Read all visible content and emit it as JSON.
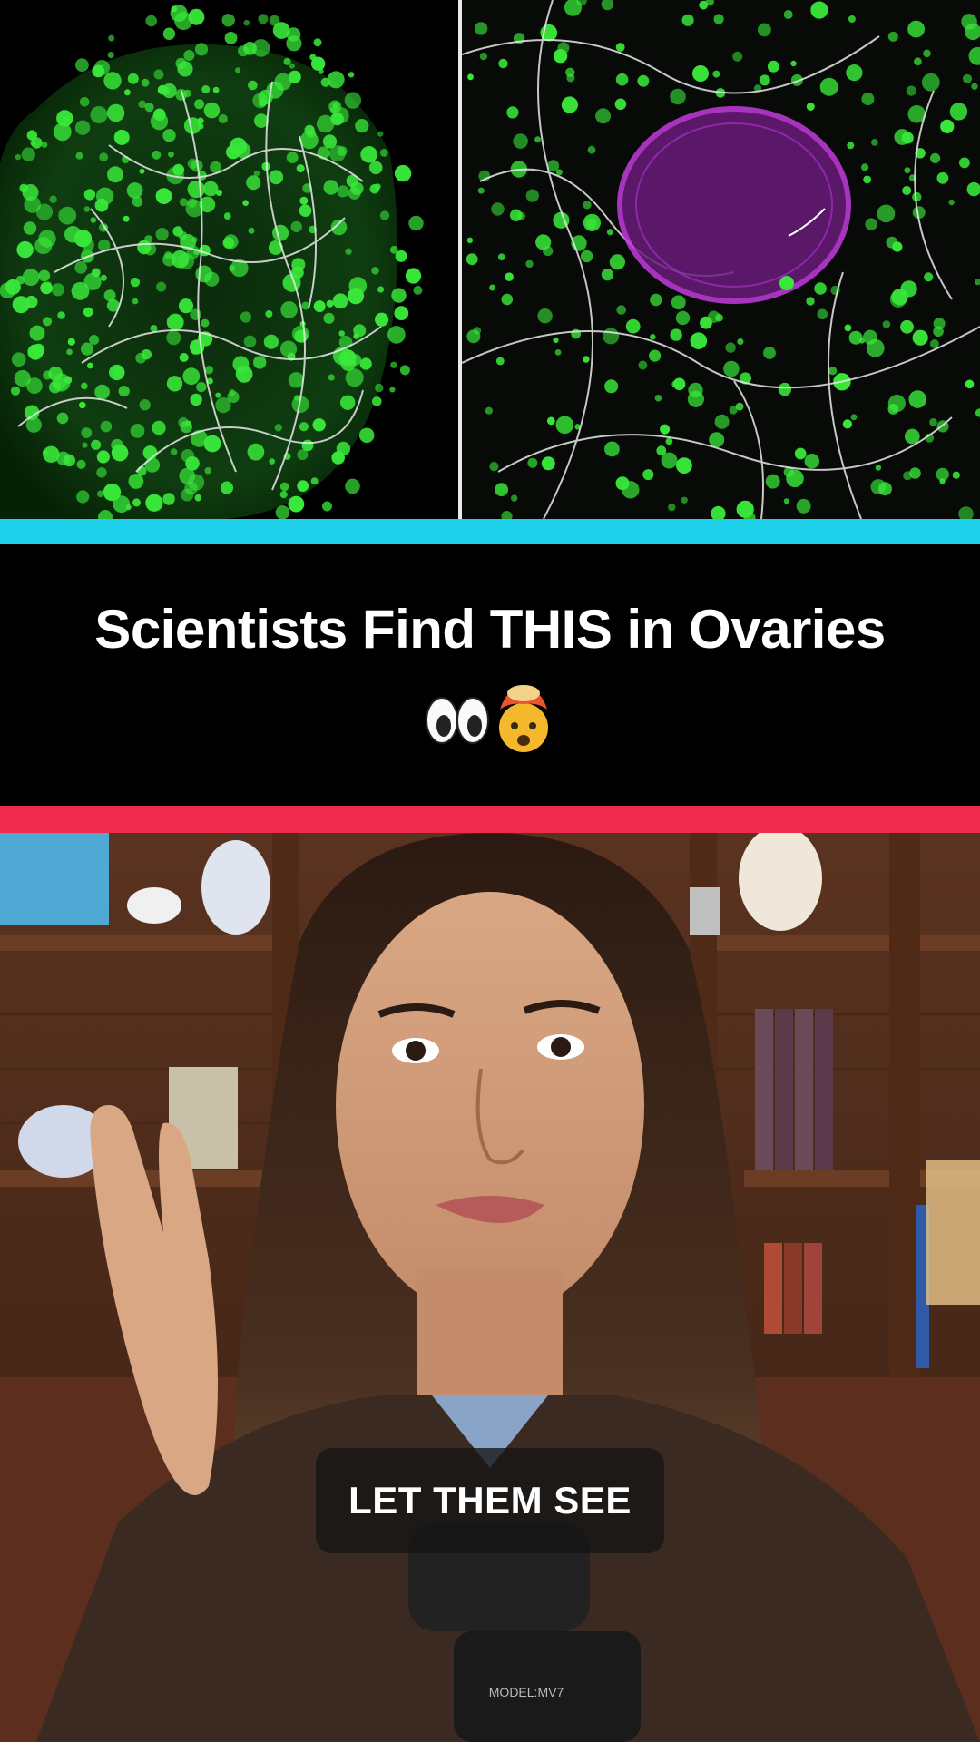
{
  "post": {
    "title": "Scientists Find THIS in Ovaries",
    "emojis": [
      "eyes-emoji",
      "exploding-head-emoji"
    ]
  },
  "video": {
    "caption": "LET THEM SEE",
    "microphone_label": "MODEL:MV7"
  },
  "colors": {
    "cyan_accent": "#1fd0ea",
    "pink_accent": "#f02a4c",
    "fluorescent_green": "#39e83a",
    "magenta_oocyte": "#c43be0"
  }
}
